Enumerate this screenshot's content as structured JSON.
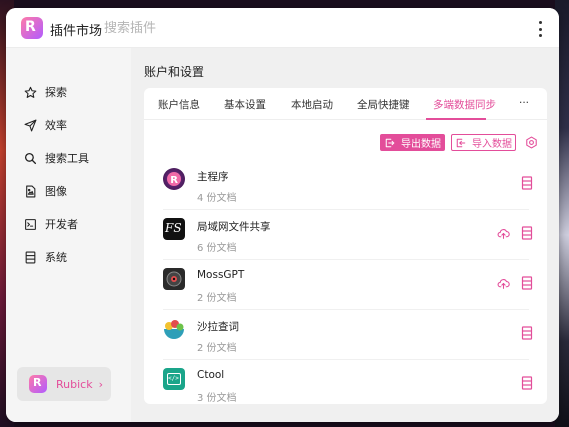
{
  "header": {
    "logo_letter": "R",
    "app_name": "插件市场",
    "search_placeholder": "搜索插件"
  },
  "sidebar": {
    "items": [
      {
        "label": "探索",
        "icon": "star-icon"
      },
      {
        "label": "效率",
        "icon": "send-icon"
      },
      {
        "label": "搜索工具",
        "icon": "search-icon"
      },
      {
        "label": "图像",
        "icon": "image-file-icon"
      },
      {
        "label": "开发者",
        "icon": "terminal-icon"
      },
      {
        "label": "系统",
        "icon": "system-list-icon"
      }
    ],
    "footer": {
      "label": "Rubick",
      "logo_letter": "R",
      "chevron": "›"
    }
  },
  "main": {
    "title": "账户和设置",
    "tabs": [
      {
        "label": "账户信息",
        "active": false
      },
      {
        "label": "基本设置",
        "active": false
      },
      {
        "label": "本地启动",
        "active": false
      },
      {
        "label": "全局快捷键",
        "active": false
      },
      {
        "label": "多端数据同步",
        "active": true
      },
      {
        "label": "···",
        "active": false
      }
    ],
    "toolbar": {
      "export_label": "导出数据",
      "import_label": "导入数据"
    },
    "plugins": [
      {
        "name": "主程序",
        "count": "4 份文档",
        "cloud": false
      },
      {
        "name": "局域网文件共享",
        "count": "6 份文档",
        "cloud": true
      },
      {
        "name": "MossGPT",
        "count": "2 份文档",
        "cloud": true
      },
      {
        "name": "沙拉查词",
        "count": "2 份文档",
        "cloud": false
      },
      {
        "name": "Ctool",
        "count": "3 份文档",
        "cloud": false
      }
    ],
    "plugin_icon_texts": {
      "file_share": "FS",
      "ctool": "</>"
    }
  },
  "colors": {
    "accent": "#e34d9a",
    "sidebar_bg": "#f5f5f5",
    "content_bg": "#f0f0f0"
  }
}
